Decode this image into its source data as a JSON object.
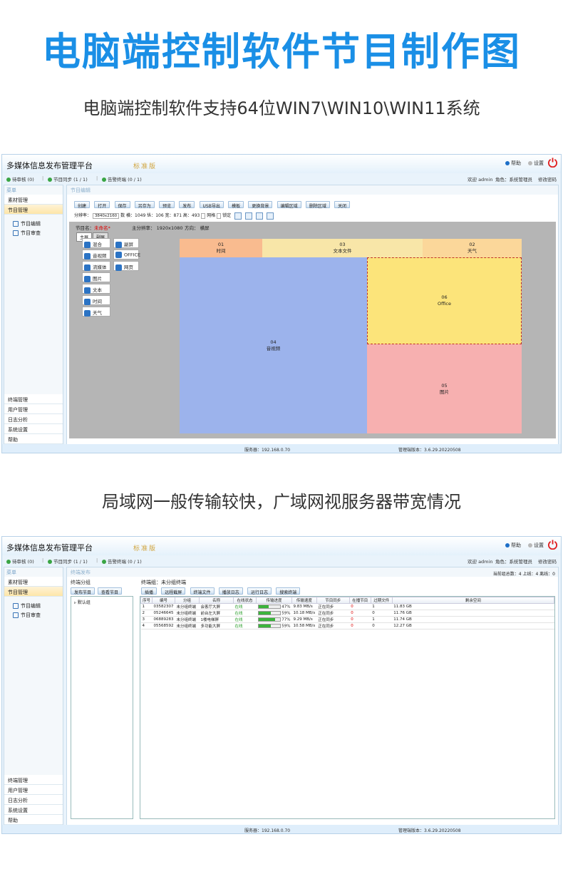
{
  "hero": {
    "title": "电脑端控制软件节目制作图",
    "subtitle1": "电脑端控制软件支持64位WIN7\\WIN10\\WIN11系统",
    "subtitle2": "局域网一般传输较快，广域网视服务器带宽情况"
  },
  "app": {
    "title": "多媒体信息发布管理平台",
    "edition": "标准版",
    "help": "帮助",
    "settings": "设置",
    "user_label": "欢迎 admin",
    "role_label": "角色：系统管理员",
    "change_password": "修改密码",
    "status": {
      "pending": "待审核 (0)",
      "sync": "节目同步 (1 / 1)",
      "alarm": "告警终端 (0 / 1)"
    },
    "menu_header": "菜单",
    "menu_top": [
      "素材管理",
      "节目管理"
    ],
    "menu_sub": [
      "节目编辑",
      "节目审查"
    ],
    "menu_bottom": [
      "终端管理",
      "用户管理",
      "日志分析",
      "系统设置",
      "帮助"
    ],
    "footer_server": "服务器：192.168.0.70",
    "footer_version": "管理端版本：3.6.29.20220508"
  },
  "editor": {
    "header": "节目编辑",
    "toolbar": [
      "创建",
      "打开",
      "保存",
      "另存为",
      "预览",
      "发布",
      "USB导出",
      "模板",
      "更换背景",
      "编辑区域",
      "删除区域",
      "关闭"
    ],
    "resolution_label": "分辨率：",
    "resolution_value": "3840x2160",
    "params_text": "数 横：1049 纵：106 宽：871 高：493",
    "grid_label": "网格",
    "lock_label": "锁定",
    "program_name_label": "节目名：",
    "program_name_value": "未命名*",
    "main_resolution": "主分辨率： 1920x1080",
    "direction": "方向： 横屏",
    "tabs": [
      "主屏",
      "副屏"
    ],
    "palette": [
      "混合",
      "副屏",
      "音视频",
      "OFFICE",
      "流媒体",
      "网页",
      "图片",
      "文本",
      "时间",
      "天气"
    ],
    "zones": [
      {
        "id": "01",
        "label": "时间",
        "color": "#f9bb8f"
      },
      {
        "id": "03",
        "label": "文本文件",
        "color": "#f8e6a8"
      },
      {
        "id": "02",
        "label": "天气",
        "color": "#fbd79a"
      },
      {
        "id": "04",
        "label": "音视频",
        "color": "#9cb3ec"
      },
      {
        "id": "06",
        "label": "Office",
        "color": "#fce47a"
      },
      {
        "id": "05",
        "label": "图片",
        "color": "#f7b0b0"
      }
    ]
  },
  "terminal": {
    "header": "终端发布",
    "group_label": "终端分组",
    "group_buttons": [
      "发布节目",
      "查看节目"
    ],
    "group_tree": "默认组",
    "terminal_group": "终端组：未分组终端",
    "count_line": "当前组总数：4  上线：4  离线：0",
    "buttons": [
      "插播",
      "远程截屏",
      "终端文件",
      "播放日志",
      "运行日志",
      "搜索终端"
    ],
    "columns": [
      "序号",
      "编号",
      "分组",
      "名称",
      "在线状态",
      "传输进度",
      "传输速度",
      "节目同步",
      "在播节目",
      "过期文件",
      "剩余空间"
    ],
    "rows": [
      {
        "n": "1",
        "id": "03582307",
        "group": "未分组终端",
        "name": "会客厅大屏",
        "status": "在线",
        "progress": 47,
        "progress_text": "47%",
        "speed": "9.83 MB/s",
        "sync": "正在同步",
        "playing": "0",
        "expired": "1",
        "space": "11.83 GB"
      },
      {
        "n": "2",
        "id": "05246645",
        "group": "未分组终端",
        "name": "前台左大屏",
        "status": "在线",
        "progress": 59,
        "progress_text": "59%",
        "speed": "10.18 MB/s",
        "sync": "正在同步",
        "playing": "0",
        "expired": "0",
        "space": "11.76 GB"
      },
      {
        "n": "3",
        "id": "06889283",
        "group": "未分组终端",
        "name": "1楼电梯屏",
        "status": "在线",
        "progress": 77,
        "progress_text": "77%",
        "speed": "9.29 MB/s",
        "sync": "正在同步",
        "playing": "0",
        "expired": "1",
        "space": "11.74 GB"
      },
      {
        "n": "4",
        "id": "05568592",
        "group": "未分组终端",
        "name": "多功能大屏",
        "status": "在线",
        "progress": 59,
        "progress_text": "59%",
        "speed": "10.58 MB/s",
        "sync": "正在同步",
        "playing": "0",
        "expired": "0",
        "space": "12.27 GB"
      }
    ]
  },
  "colors": {
    "accent": "#1a8fe6",
    "online": "#2a9d2a"
  }
}
